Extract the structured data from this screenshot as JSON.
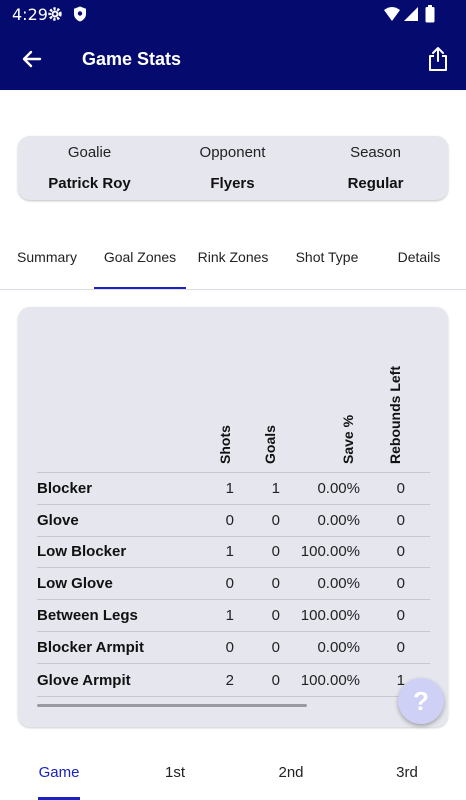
{
  "status_bar": {
    "time": "4:29"
  },
  "app_bar": {
    "title": "Game Stats"
  },
  "info": [
    {
      "label": "Goalie",
      "value": "Patrick Roy"
    },
    {
      "label": "Opponent",
      "value": "Flyers"
    },
    {
      "label": "Season",
      "value": "Regular"
    }
  ],
  "tabs": [
    "Summary",
    "Goal Zones",
    "Rink Zones",
    "Shot Type",
    "Details"
  ],
  "selected_tab": "Goal Zones",
  "table": {
    "columns": [
      "Shots",
      "Goals",
      "Save %",
      "Rebounds Left"
    ],
    "rows": [
      {
        "zone": "Blocker",
        "shots": "1",
        "goals": "1",
        "save_pct": "0.00%",
        "rebounds_left": "0"
      },
      {
        "zone": "Glove",
        "shots": "0",
        "goals": "0",
        "save_pct": "0.00%",
        "rebounds_left": "0"
      },
      {
        "zone": "Low Blocker",
        "shots": "1",
        "goals": "0",
        "save_pct": "100.00%",
        "rebounds_left": "0"
      },
      {
        "zone": "Low Glove",
        "shots": "0",
        "goals": "0",
        "save_pct": "0.00%",
        "rebounds_left": "0"
      },
      {
        "zone": "Between Legs",
        "shots": "1",
        "goals": "0",
        "save_pct": "100.00%",
        "rebounds_left": "0"
      },
      {
        "zone": "Blocker Armpit",
        "shots": "0",
        "goals": "0",
        "save_pct": "0.00%",
        "rebounds_left": "0"
      },
      {
        "zone": "Glove Armpit",
        "shots": "2",
        "goals": "0",
        "save_pct": "100.00%",
        "rebounds_left": "1"
      }
    ]
  },
  "fab": {
    "label": "?"
  },
  "bottom_tabs": [
    "Game",
    "1st",
    "2nd",
    "3rd"
  ],
  "selected_bottom_tab": "Game",
  "colors": {
    "app_bar": "#050a6e",
    "accent": "#1a22c4",
    "card": "#e6e6ee",
    "fab": "#cfd0f5"
  }
}
